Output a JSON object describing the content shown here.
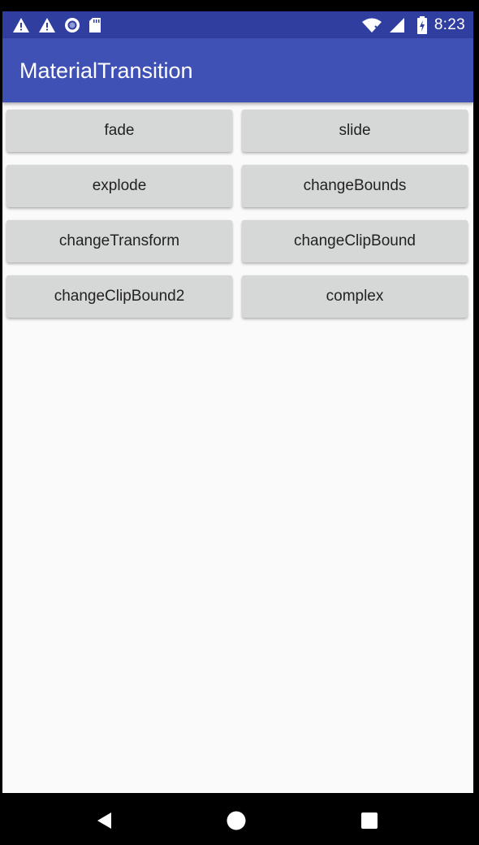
{
  "status_bar": {
    "time": "8:23",
    "left_icons": [
      "warning-icon",
      "warning-icon",
      "sync-circle-icon",
      "sd-card-icon"
    ],
    "right_icons": [
      "wifi-icon",
      "cell-signal-icon",
      "battery-charging-icon"
    ]
  },
  "toolbar": {
    "title": "MaterialTransition"
  },
  "buttons": [
    {
      "label": "fade"
    },
    {
      "label": "slide"
    },
    {
      "label": "explode"
    },
    {
      "label": "changeBounds"
    },
    {
      "label": "changeTransform"
    },
    {
      "label": "changeClipBound"
    },
    {
      "label": "changeClipBound2"
    },
    {
      "label": "complex"
    }
  ],
  "nav_bar": {
    "icons": [
      "back-icon",
      "home-icon",
      "recents-icon"
    ]
  },
  "colors": {
    "status_bar": "#303f9f",
    "toolbar": "#3f51b5",
    "button": "#d6d7d7",
    "background": "#fafafa"
  }
}
